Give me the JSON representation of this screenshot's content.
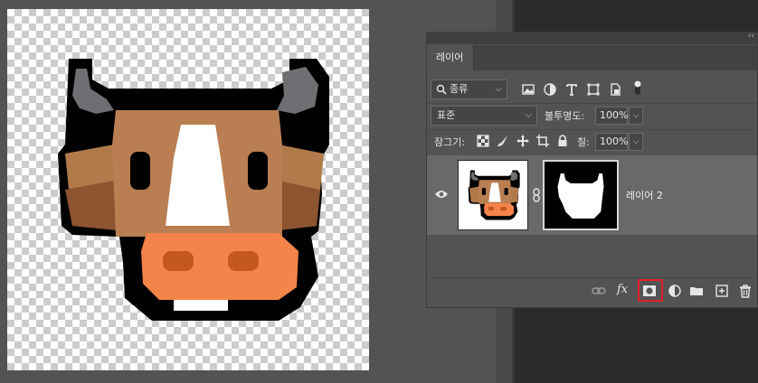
{
  "panel": {
    "tab_label": "레이어",
    "collapse_glyph": "‹‹",
    "filter": {
      "value": "종류",
      "icon": "search-icon"
    },
    "blend": {
      "value": "표준",
      "opacity_label": "불투명도:",
      "opacity_value": "100%"
    },
    "lock": {
      "label": "잠그기:",
      "fill_label": "칠:",
      "fill_value": "100%"
    },
    "layer": {
      "name": "레이어 2"
    },
    "footer_fx": "fx"
  },
  "colors": {
    "highlight": "#e0202a",
    "panel_bg": "#535353",
    "selected_row": "#696969"
  }
}
